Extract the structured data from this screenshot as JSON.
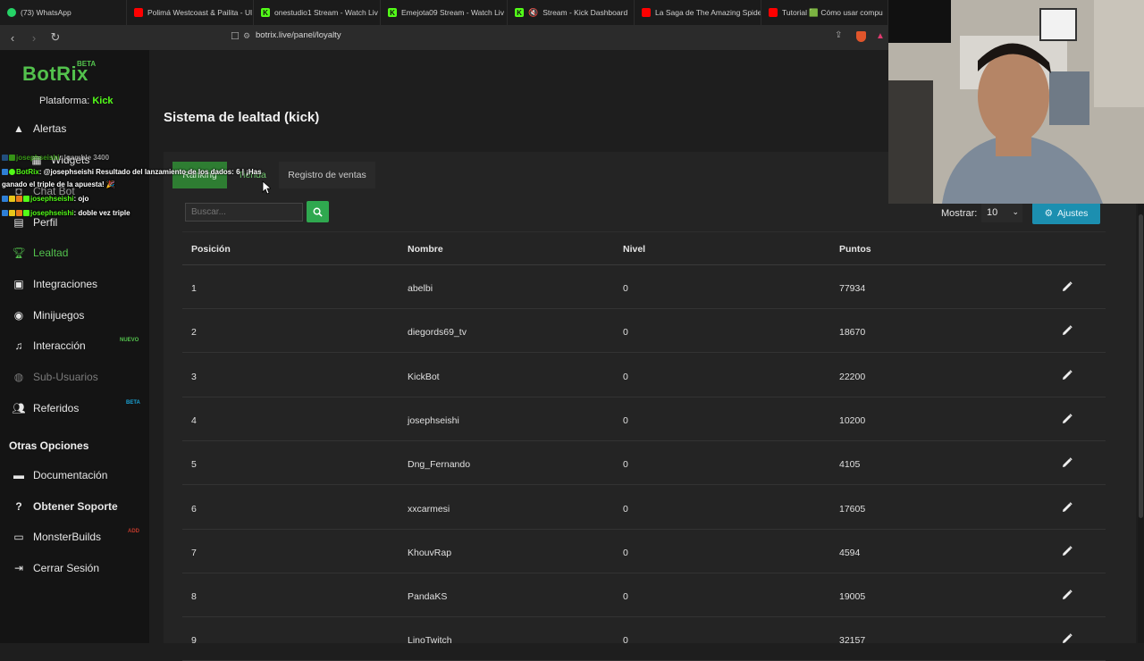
{
  "browser": {
    "tabs": [
      {
        "label": "(73) WhatsApp",
        "color": "#25d366"
      },
      {
        "label": "Polimá Westcoast & Pailita - Ul",
        "color": "#ff0000"
      },
      {
        "label": "onestudio1 Stream - Watch Liv",
        "color": "#53fc18"
      },
      {
        "label": "Emejota09 Stream - Watch Liv",
        "color": "#53fc18"
      },
      {
        "label": "Stream - Kick Dashboard",
        "color": "#53fc18"
      },
      {
        "label": "La Saga de The Amazing Spide",
        "color": "#ff0000"
      },
      {
        "label": "Tutorial 🟩 Cómo usar compu",
        "color": "#ff0000"
      }
    ],
    "url": "botrix.live/panel/loyalty"
  },
  "sidebar": {
    "logo": "BotRix",
    "logo_badge": "BETA",
    "platform_label": "Plataforma:",
    "platform_value": "Kick",
    "items": [
      {
        "label": "Alertas",
        "icon": "warning-icon"
      },
      {
        "label": "Widgets",
        "icon": "widgets-icon"
      },
      {
        "label": "Chat Bot",
        "icon": "robot-icon"
      },
      {
        "label": "Perfil",
        "icon": "profile-icon"
      },
      {
        "label": "Lealtad",
        "icon": "trophy-icon"
      },
      {
        "label": "Integraciones",
        "icon": "integrations-icon"
      },
      {
        "label": "Minijuegos",
        "icon": "gamepad-icon"
      },
      {
        "label": "Interacción",
        "icon": "music-icon",
        "badge": "NUEVO"
      },
      {
        "label": "Sub-Usuarios",
        "icon": "users-icon"
      },
      {
        "label": "Referidos",
        "icon": "referrals-icon",
        "badge": "BETA"
      }
    ],
    "section_title": "Otras Opciones",
    "other_items": [
      {
        "label": "Documentación",
        "icon": "book-icon"
      },
      {
        "label": "Obtener Soporte",
        "icon": "help-icon"
      },
      {
        "label": "MonsterBuilds",
        "icon": "monitor-icon",
        "badge": "ADD"
      },
      {
        "label": "Cerrar Sesión",
        "icon": "logout-icon"
      }
    ]
  },
  "chat_overlay": {
    "lines": [
      {
        "user": "josephseishi",
        "text": ": !gamble 3400"
      },
      {
        "user": "BotRix",
        "text": ": @josephseishi Resultado del lanzamiento de los dados: 6 | ¡Has"
      },
      {
        "user": "",
        "text": "ganado el triple de la apuesta! 🎉"
      },
      {
        "user": "josephseishi",
        "text": ": ojo"
      },
      {
        "user": "josephseishi",
        "text": ": doble vez triple"
      }
    ]
  },
  "page": {
    "title": "Sistema de lealtad (kick)",
    "tabs": [
      "Ranking",
      "Tienda",
      "Registro de ventas"
    ],
    "search_placeholder": "Buscar...",
    "show_label": "Mostrar:",
    "show_value": "10",
    "settings_label": "Ajustes"
  },
  "table": {
    "headers": [
      "Posición",
      "Nombre",
      "Nivel",
      "Puntos"
    ],
    "rows": [
      {
        "pos": "1",
        "name": "abelbi",
        "level": "0",
        "points": "77934"
      },
      {
        "pos": "2",
        "name": "diegords69_tv",
        "level": "0",
        "points": "18670"
      },
      {
        "pos": "3",
        "name": "KickBot",
        "level": "0",
        "points": "22200"
      },
      {
        "pos": "4",
        "name": "josephseishi",
        "level": "0",
        "points": "10200"
      },
      {
        "pos": "5",
        "name": "Dng_Fernando",
        "level": "0",
        "points": "4105"
      },
      {
        "pos": "6",
        "name": "xxcarmesi",
        "level": "0",
        "points": "17605"
      },
      {
        "pos": "7",
        "name": "KhouvRap",
        "level": "0",
        "points": "4594"
      },
      {
        "pos": "8",
        "name": "PandaKS",
        "level": "0",
        "points": "19005"
      },
      {
        "pos": "9",
        "name": "LinoTwitch",
        "level": "0",
        "points": "32157"
      }
    ]
  },
  "colors": {
    "accent": "#53c24d",
    "kick": "#53fc18",
    "info": "#1c8fb0"
  }
}
